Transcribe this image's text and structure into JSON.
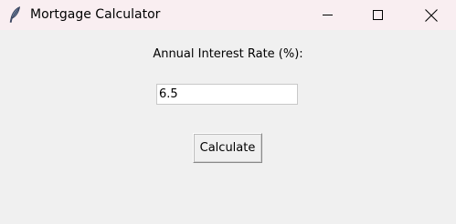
{
  "window": {
    "title": "Mortgage Calculator",
    "icon": "feather-icon",
    "controls": {
      "minimize_icon": "minimize-icon",
      "maximize_icon": "maximize-icon",
      "close_icon": "close-icon"
    }
  },
  "form": {
    "rate_label": "Annual Interest Rate (%):",
    "rate_value": "6.5",
    "calculate_label": "Calculate"
  },
  "colors": {
    "titlebar_bg": "#f9eef1",
    "window_bg": "#f0f0f0",
    "input_bg": "#ffffff"
  }
}
